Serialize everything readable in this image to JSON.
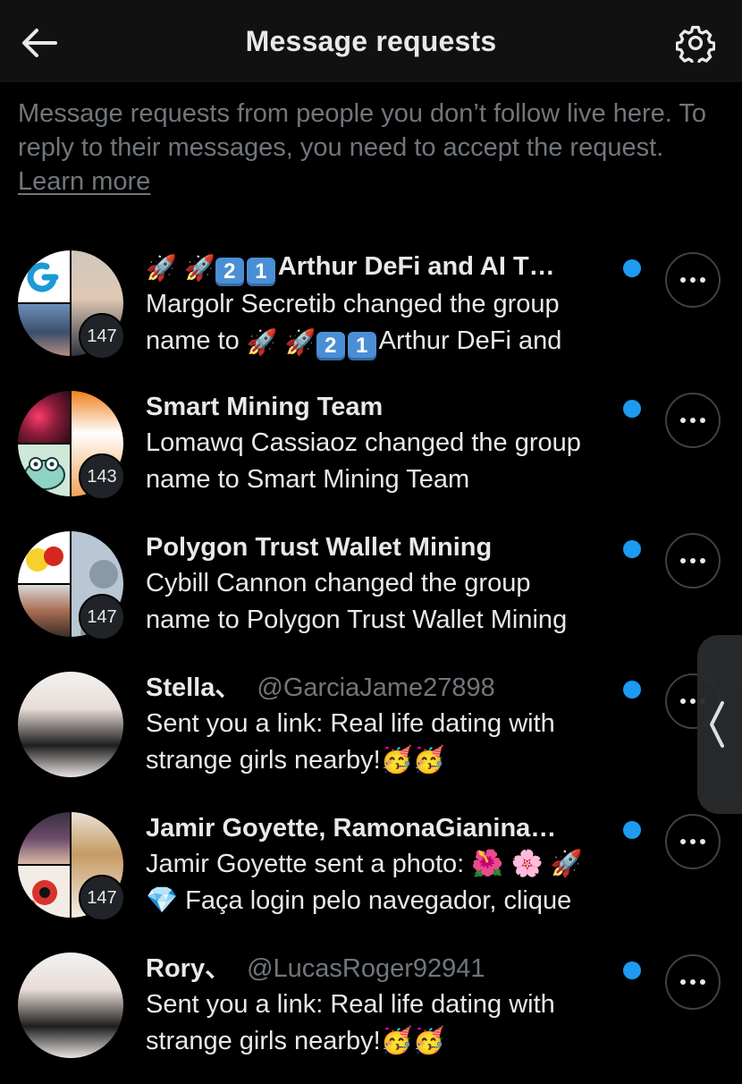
{
  "header": {
    "title": "Message requests",
    "back_icon": "arrow-left-icon",
    "settings_icon": "gear-icon"
  },
  "intro": {
    "text": "Message requests from people you don’t follow live here. To reply to their messages, you need to accept the request.",
    "link": "Learn more"
  },
  "colors": {
    "background": "#000000",
    "header_bg": "#111111",
    "text_primary": "#e7e9ea",
    "text_secondary": "#71767b",
    "unread_dot": "#1d9bf0"
  },
  "requests": [
    {
      "title": "🚀 🚀2️⃣1️⃣Arthur DeFi and AI T…",
      "handle": "",
      "preview_line1": "Margolr Secretib changed the group",
      "preview_line2": "name to 🚀 🚀2️⃣1️⃣Arthur DeFi and",
      "count": "147",
      "unread": true
    },
    {
      "title": "Smart Mining Team",
      "handle": "",
      "preview_line1": "Lomawq Cassiaoz changed the group",
      "preview_line2": "name to Smart Mining Team",
      "count": "143",
      "unread": true
    },
    {
      "title": "Polygon Trust Wallet Mining",
      "handle": "",
      "preview_line1": "Cybill Cannon changed the group",
      "preview_line2": "name to Polygon Trust Wallet Mining",
      "count": "147",
      "unread": true
    },
    {
      "title": "Stella、",
      "handle": "@GarciaJame27898",
      "preview_line1": "Sent you a link: Real life dating with",
      "preview_line2": "strange girls nearby!🥳🥳",
      "count": "",
      "unread": true
    },
    {
      "title": "Jamir Goyette, RamonaGianina…",
      "handle": "",
      "preview_line1": "Jamir Goyette sent a photo: 🌺 🌸 🚀",
      "preview_line2": "💎 Faça login pelo navegador, clique",
      "count": "147",
      "unread": true
    },
    {
      "title": "Rory、",
      "handle": "@LucasRoger92941",
      "preview_line1": "Sent you a link: Real life dating with",
      "preview_line2": "strange girls nearby!🥳🥳",
      "count": "",
      "unread": true
    }
  ]
}
